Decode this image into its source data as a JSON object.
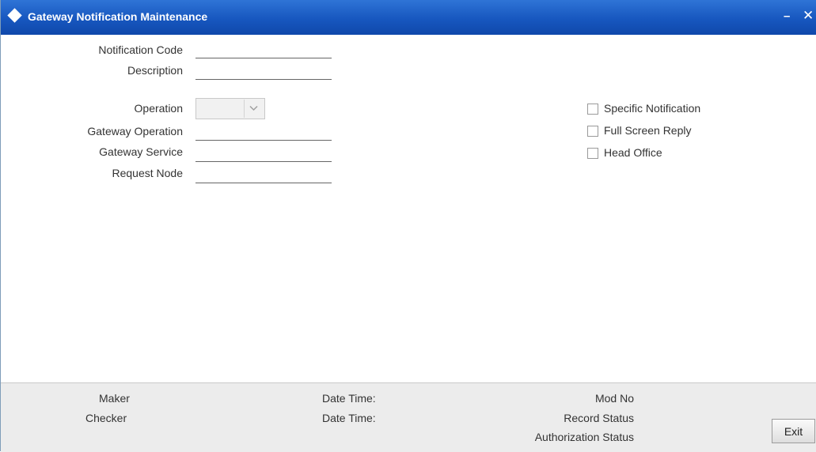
{
  "window": {
    "title": "Gateway Notification Maintenance",
    "minimize_label": "–",
    "close_label": "✕"
  },
  "form": {
    "notification_code": {
      "label": "Notification Code",
      "value": ""
    },
    "description": {
      "label": "Description",
      "value": ""
    },
    "operation": {
      "label": "Operation",
      "value": ""
    },
    "gateway_operation": {
      "label": "Gateway Operation",
      "value": ""
    },
    "gateway_service": {
      "label": "Gateway Service",
      "value": ""
    },
    "request_node": {
      "label": "Request Node",
      "value": ""
    }
  },
  "checkboxes": {
    "specific_notification": {
      "label": "Specific Notification",
      "checked": false
    },
    "full_screen_reply": {
      "label": "Full Screen Reply",
      "checked": false
    },
    "head_office": {
      "label": "Head Office",
      "checked": false
    }
  },
  "footer": {
    "maker_label": "Maker",
    "checker_label": "Checker",
    "maker_datetime_label": "Date Time:",
    "checker_datetime_label": "Date Time:",
    "mod_no_label": "Mod No",
    "record_status_label": "Record Status",
    "authorization_status_label": "Authorization Status",
    "exit_label": "Exit"
  },
  "colors": {
    "titlebar": "#1757bf",
    "footer_bg": "#ececec"
  },
  "icons": {
    "title": "diamond-icon",
    "dropdown": "chevron-down-icon"
  }
}
